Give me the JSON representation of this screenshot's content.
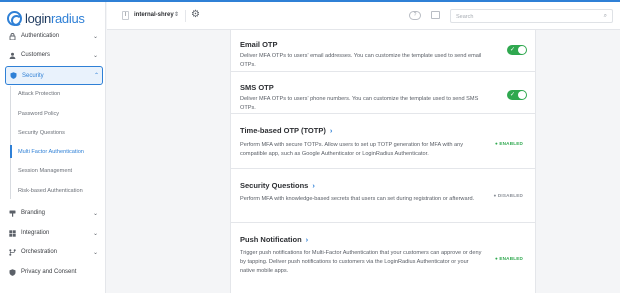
{
  "brand": {
    "name_part1": "login",
    "name_part2": "radius",
    "accent": "#2f80d6"
  },
  "topbar": {
    "site_badge": "I",
    "site_name": "internal-shrey",
    "site_chevron": "⌃⌄",
    "search_placeholder": "Search"
  },
  "sidebar": {
    "items": [
      {
        "label": "Authentication",
        "icon": "lock-icon",
        "expanded": false
      },
      {
        "label": "Customers",
        "icon": "user-icon",
        "expanded": false
      },
      {
        "label": "Security",
        "icon": "shield-icon",
        "expanded": true
      },
      {
        "label": "Branding",
        "icon": "palette-icon",
        "expanded": false
      },
      {
        "label": "Integration",
        "icon": "grid-icon",
        "expanded": false
      },
      {
        "label": "Orchestration",
        "icon": "flow-icon",
        "expanded": false
      },
      {
        "label": "Privacy and Consent",
        "icon": "privacy-icon",
        "expanded": false
      }
    ],
    "security_subitems": [
      "Attack Protection",
      "Password Policy",
      "Security Questions",
      "Multi Factor Authentication",
      "Session Management",
      "Risk-based Authentication"
    ],
    "selected_subitem": "Multi Factor Authentication"
  },
  "mfa_methods": [
    {
      "title": "Email OTP",
      "description": "Deliver MFA OTPs to users' email addresses. You can customize the template used to send email OTPs.",
      "control": "toggle",
      "enabled": true
    },
    {
      "title": "SMS OTP",
      "description": "Deliver MFA OTPs to users' phone numbers. You can customize the template used to send SMS OTPs.",
      "control": "toggle",
      "enabled": true
    },
    {
      "title": "Time-based OTP (TOTP)",
      "description": "Perform MFA with secure TOTPs. Allow users to set up TOTP generation for MFA with any compatible app, such as Google Authenticator or LoginRadius Authenticator.",
      "control": "status",
      "status": "ENABLED"
    },
    {
      "title": "Security Questions",
      "description": "Perform MFA with knowledge-based secrets that users can set during registration or afterward.",
      "control": "status",
      "status": "DISABLED"
    },
    {
      "title": "Push Notification",
      "description": "Trigger push notifications for Multi-Factor Authentication that your customers can approve or deny by tapping. Deliver push notifications to customers via the LoginRadius Authenticator or your native mobile apps.",
      "control": "status",
      "status": "ENABLED"
    }
  ],
  "colors": {
    "enabled": "#2fa84f",
    "disabled": "#8a8f97",
    "border": "#e4e6ea"
  }
}
